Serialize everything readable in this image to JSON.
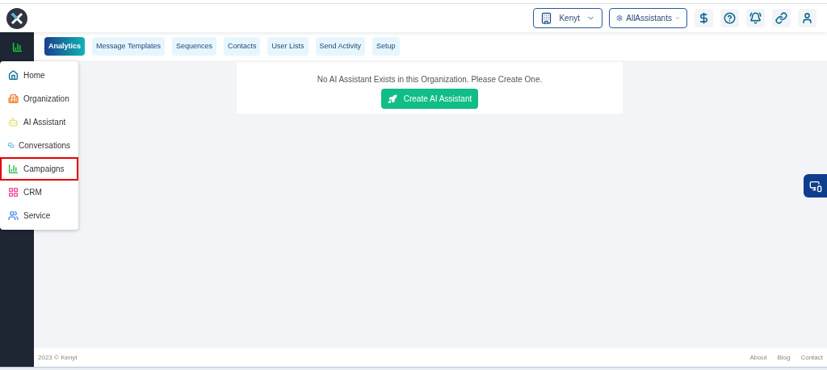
{
  "header": {
    "org_select": "Kenyt",
    "assistant_select": "AllAssistants"
  },
  "tabs": [
    {
      "label": "Analytics",
      "selected": true
    },
    {
      "label": "Message Templates",
      "selected": false
    },
    {
      "label": "Sequences",
      "selected": false
    },
    {
      "label": "Contacts",
      "selected": false
    },
    {
      "label": "User Lists",
      "selected": false
    },
    {
      "label": "Send Activity",
      "selected": false
    },
    {
      "label": "Setup",
      "selected": false
    }
  ],
  "menu": [
    {
      "kind": "home",
      "label": "Home",
      "selected": false
    },
    {
      "kind": "organization",
      "label": "Organization",
      "selected": false
    },
    {
      "kind": "assistant",
      "label": "AI Assistant",
      "selected": false
    },
    {
      "kind": "conversations",
      "label": "Conversations",
      "selected": false
    },
    {
      "kind": "campaigns",
      "label": "Campaigns",
      "selected": true
    },
    {
      "kind": "crm",
      "label": "CRM",
      "selected": false
    },
    {
      "kind": "service",
      "label": "Service",
      "selected": false
    }
  ],
  "notice": {
    "message": "No AI Assistant Exists in this Organization. Please Create One.",
    "button": "Create AI Assistant"
  },
  "footer": {
    "copyright": "2023 © Kenyt",
    "links": [
      "About",
      "Blog",
      "Contact"
    ]
  }
}
